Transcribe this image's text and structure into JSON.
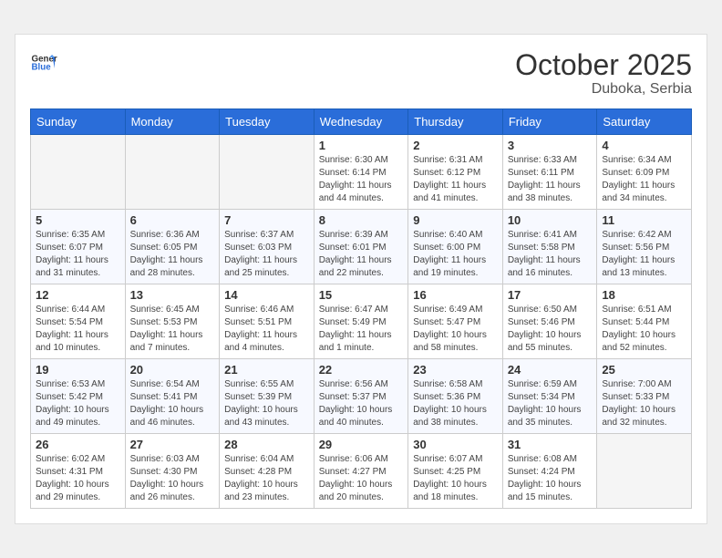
{
  "header": {
    "logo_general": "General",
    "logo_blue": "Blue",
    "month": "October 2025",
    "location": "Duboka, Serbia"
  },
  "weekdays": [
    "Sunday",
    "Monday",
    "Tuesday",
    "Wednesday",
    "Thursday",
    "Friday",
    "Saturday"
  ],
  "weeks": [
    [
      {
        "day": "",
        "info": ""
      },
      {
        "day": "",
        "info": ""
      },
      {
        "day": "",
        "info": ""
      },
      {
        "day": "1",
        "info": "Sunrise: 6:30 AM\nSunset: 6:14 PM\nDaylight: 11 hours\nand 44 minutes."
      },
      {
        "day": "2",
        "info": "Sunrise: 6:31 AM\nSunset: 6:12 PM\nDaylight: 11 hours\nand 41 minutes."
      },
      {
        "day": "3",
        "info": "Sunrise: 6:33 AM\nSunset: 6:11 PM\nDaylight: 11 hours\nand 38 minutes."
      },
      {
        "day": "4",
        "info": "Sunrise: 6:34 AM\nSunset: 6:09 PM\nDaylight: 11 hours\nand 34 minutes."
      }
    ],
    [
      {
        "day": "5",
        "info": "Sunrise: 6:35 AM\nSunset: 6:07 PM\nDaylight: 11 hours\nand 31 minutes."
      },
      {
        "day": "6",
        "info": "Sunrise: 6:36 AM\nSunset: 6:05 PM\nDaylight: 11 hours\nand 28 minutes."
      },
      {
        "day": "7",
        "info": "Sunrise: 6:37 AM\nSunset: 6:03 PM\nDaylight: 11 hours\nand 25 minutes."
      },
      {
        "day": "8",
        "info": "Sunrise: 6:39 AM\nSunset: 6:01 PM\nDaylight: 11 hours\nand 22 minutes."
      },
      {
        "day": "9",
        "info": "Sunrise: 6:40 AM\nSunset: 6:00 PM\nDaylight: 11 hours\nand 19 minutes."
      },
      {
        "day": "10",
        "info": "Sunrise: 6:41 AM\nSunset: 5:58 PM\nDaylight: 11 hours\nand 16 minutes."
      },
      {
        "day": "11",
        "info": "Sunrise: 6:42 AM\nSunset: 5:56 PM\nDaylight: 11 hours\nand 13 minutes."
      }
    ],
    [
      {
        "day": "12",
        "info": "Sunrise: 6:44 AM\nSunset: 5:54 PM\nDaylight: 11 hours\nand 10 minutes."
      },
      {
        "day": "13",
        "info": "Sunrise: 6:45 AM\nSunset: 5:53 PM\nDaylight: 11 hours\nand 7 minutes."
      },
      {
        "day": "14",
        "info": "Sunrise: 6:46 AM\nSunset: 5:51 PM\nDaylight: 11 hours\nand 4 minutes."
      },
      {
        "day": "15",
        "info": "Sunrise: 6:47 AM\nSunset: 5:49 PM\nDaylight: 11 hours\nand 1 minute."
      },
      {
        "day": "16",
        "info": "Sunrise: 6:49 AM\nSunset: 5:47 PM\nDaylight: 10 hours\nand 58 minutes."
      },
      {
        "day": "17",
        "info": "Sunrise: 6:50 AM\nSunset: 5:46 PM\nDaylight: 10 hours\nand 55 minutes."
      },
      {
        "day": "18",
        "info": "Sunrise: 6:51 AM\nSunset: 5:44 PM\nDaylight: 10 hours\nand 52 minutes."
      }
    ],
    [
      {
        "day": "19",
        "info": "Sunrise: 6:53 AM\nSunset: 5:42 PM\nDaylight: 10 hours\nand 49 minutes."
      },
      {
        "day": "20",
        "info": "Sunrise: 6:54 AM\nSunset: 5:41 PM\nDaylight: 10 hours\nand 46 minutes."
      },
      {
        "day": "21",
        "info": "Sunrise: 6:55 AM\nSunset: 5:39 PM\nDaylight: 10 hours\nand 43 minutes."
      },
      {
        "day": "22",
        "info": "Sunrise: 6:56 AM\nSunset: 5:37 PM\nDaylight: 10 hours\nand 40 minutes."
      },
      {
        "day": "23",
        "info": "Sunrise: 6:58 AM\nSunset: 5:36 PM\nDaylight: 10 hours\nand 38 minutes."
      },
      {
        "day": "24",
        "info": "Sunrise: 6:59 AM\nSunset: 5:34 PM\nDaylight: 10 hours\nand 35 minutes."
      },
      {
        "day": "25",
        "info": "Sunrise: 7:00 AM\nSunset: 5:33 PM\nDaylight: 10 hours\nand 32 minutes."
      }
    ],
    [
      {
        "day": "26",
        "info": "Sunrise: 6:02 AM\nSunset: 4:31 PM\nDaylight: 10 hours\nand 29 minutes."
      },
      {
        "day": "27",
        "info": "Sunrise: 6:03 AM\nSunset: 4:30 PM\nDaylight: 10 hours\nand 26 minutes."
      },
      {
        "day": "28",
        "info": "Sunrise: 6:04 AM\nSunset: 4:28 PM\nDaylight: 10 hours\nand 23 minutes."
      },
      {
        "day": "29",
        "info": "Sunrise: 6:06 AM\nSunset: 4:27 PM\nDaylight: 10 hours\nand 20 minutes."
      },
      {
        "day": "30",
        "info": "Sunrise: 6:07 AM\nSunset: 4:25 PM\nDaylight: 10 hours\nand 18 minutes."
      },
      {
        "day": "31",
        "info": "Sunrise: 6:08 AM\nSunset: 4:24 PM\nDaylight: 10 hours\nand 15 minutes."
      },
      {
        "day": "",
        "info": ""
      }
    ]
  ]
}
